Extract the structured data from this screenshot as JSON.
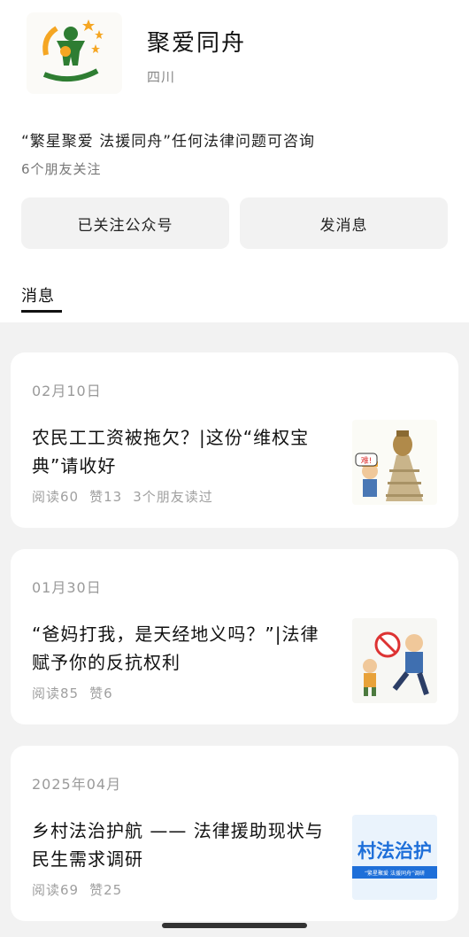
{
  "account": {
    "name": "聚爱同舟",
    "region": "四川",
    "description": "“繁星聚爱 法援同舟”任何法律问题可咨询",
    "friends_following": "6个朋友关注"
  },
  "actions": {
    "follow_label": "已关注公众号",
    "message_label": "发消息"
  },
  "tabs": [
    {
      "label": "消息",
      "active": true
    }
  ],
  "articles": [
    {
      "date": "02月10日",
      "title": "农民工工资被拖欠？|这份“维权宝典”请收好",
      "reads": "阅读60",
      "likes": "赞13",
      "friends_read": "3个朋友读过",
      "thumb_icon": "wage-claim-cartoon",
      "thumb_text": "难!"
    },
    {
      "date": "01月30日",
      "title": "“爸妈打我，是天经地义吗？”|法律赋予你的反抗权利",
      "reads": "阅读85",
      "likes": "赞6",
      "friends_read": "",
      "thumb_icon": "anti-domestic-violence-cartoon",
      "thumb_text": ""
    },
    {
      "date": "2025年04月",
      "title": "乡村法治护航 —— 法律援助现状与民生需求调研",
      "reads": "阅读69",
      "likes": "赞25",
      "friends_read": "",
      "thumb_icon": "rural-rule-of-law-banner",
      "thumb_text": "村法治护",
      "thumb_subtext": "“繁星聚爱 法援同舟”调研"
    }
  ],
  "colors": {
    "logo_green": "#2e7d32",
    "logo_orange": "#f5a623",
    "thumb_blue": "#1e6fd9"
  }
}
